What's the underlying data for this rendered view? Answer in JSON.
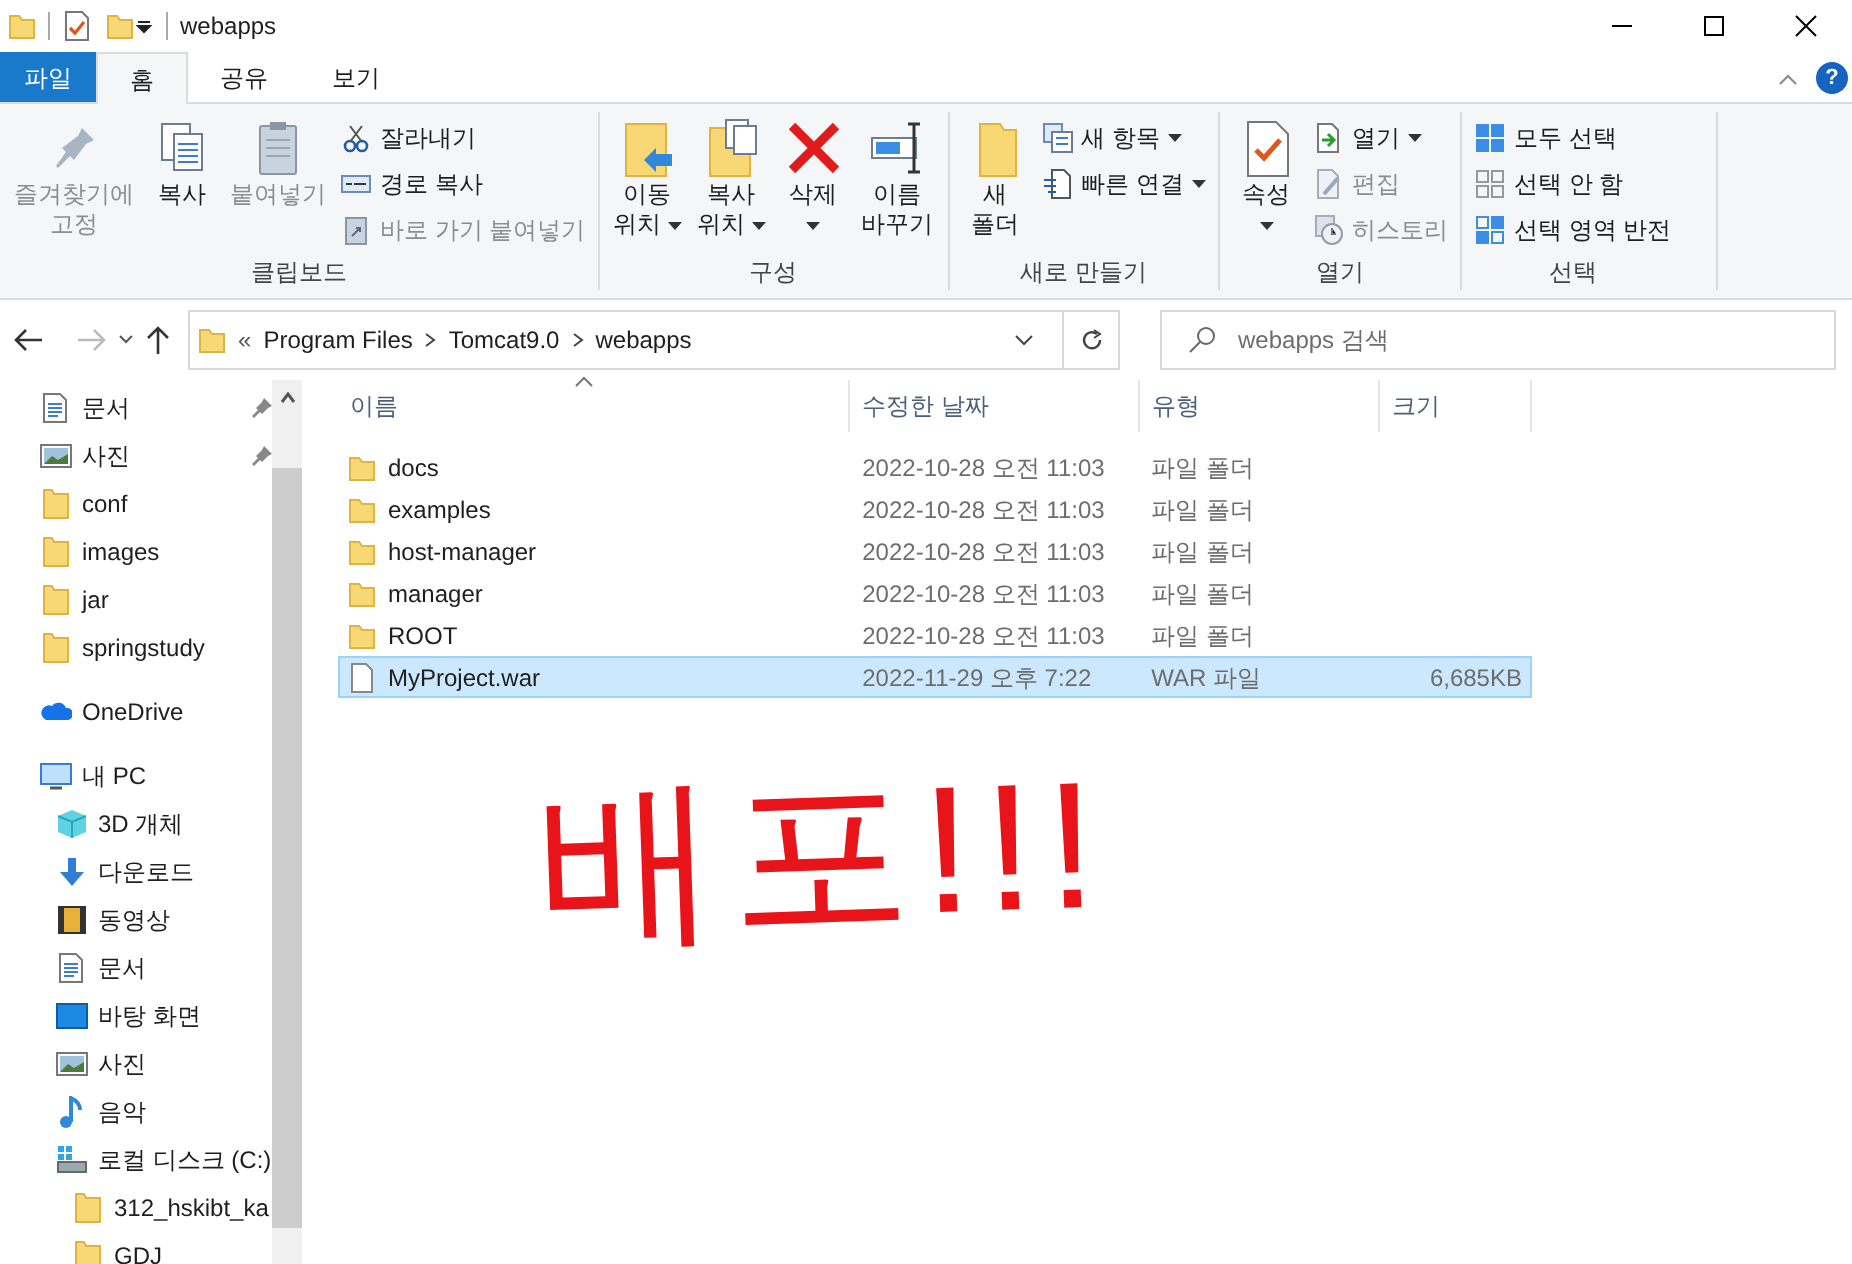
{
  "window": {
    "title": "webapps"
  },
  "help_button": {
    "label": "?"
  },
  "ribbon_tabs": [
    {
      "label": "파일",
      "kind": "file",
      "selected": false
    },
    {
      "label": "홈",
      "kind": "tab",
      "selected": true
    },
    {
      "label": "공유",
      "kind": "tab",
      "selected": false
    },
    {
      "label": "보기",
      "kind": "tab",
      "selected": false
    }
  ],
  "ribbon_groups": [
    {
      "label": "클립보드",
      "items": [
        {
          "kind": "large",
          "lines": [
            "즐겨찾기에",
            "고정"
          ],
          "disabled": true,
          "dropdown": false
        },
        {
          "kind": "large",
          "lines": [
            "복사"
          ],
          "disabled": false,
          "dropdown": false
        },
        {
          "kind": "large",
          "lines": [
            "붙여넣기"
          ],
          "disabled": true,
          "dropdown": false
        },
        {
          "kind": "stack",
          "entries": [
            {
              "label": "잘라내기",
              "disabled": false,
              "dropdown": false
            },
            {
              "label": "경로 복사",
              "disabled": false,
              "dropdown": false
            },
            {
              "label": "바로 가기 붙여넣기",
              "disabled": true,
              "dropdown": false
            }
          ]
        }
      ]
    },
    {
      "label": "구성",
      "items": [
        {
          "kind": "large",
          "lines": [
            "이동",
            "위치"
          ],
          "disabled": false,
          "dropdown": true
        },
        {
          "kind": "large",
          "lines": [
            "복사",
            "위치"
          ],
          "disabled": false,
          "dropdown": true
        },
        {
          "kind": "large",
          "lines": [
            "삭제"
          ],
          "disabled": false,
          "dropdown": true
        },
        {
          "kind": "large",
          "lines": [
            "이름",
            "바꾸기"
          ],
          "disabled": false,
          "dropdown": false
        }
      ]
    },
    {
      "label": "새로 만들기",
      "items": [
        {
          "kind": "large",
          "lines": [
            "새",
            "폴더"
          ],
          "disabled": false,
          "dropdown": false
        },
        {
          "kind": "stack",
          "entries": [
            {
              "label": "새 항목",
              "disabled": false,
              "dropdown": true
            },
            {
              "label": "빠른 연결",
              "disabled": false,
              "dropdown": true
            }
          ]
        }
      ]
    },
    {
      "label": "열기",
      "items": [
        {
          "kind": "large",
          "lines": [
            "속성"
          ],
          "disabled": false,
          "dropdown": true
        },
        {
          "kind": "stack",
          "entries": [
            {
              "label": "열기",
              "disabled": false,
              "dropdown": true
            },
            {
              "label": "편집",
              "disabled": true,
              "dropdown": false
            },
            {
              "label": "히스토리",
              "disabled": true,
              "dropdown": false
            }
          ]
        }
      ]
    },
    {
      "label": "선택",
      "items": [
        {
          "kind": "stack",
          "entries": [
            {
              "label": "모두 선택",
              "disabled": false,
              "dropdown": false
            },
            {
              "label": "선택 안 함",
              "disabled": false,
              "dropdown": false
            },
            {
              "label": "선택 영역 반전",
              "disabled": false,
              "dropdown": false
            }
          ]
        }
      ]
    }
  ],
  "address_bar": {
    "prefix": "«",
    "path": [
      "Program Files",
      "Tomcat9.0",
      "webapps"
    ]
  },
  "search": {
    "placeholder": "webapps 검색"
  },
  "sidebar": [
    {
      "label": "문서",
      "kind": "doc",
      "pinned": true
    },
    {
      "label": "사진",
      "kind": "photo",
      "pinned": true
    },
    {
      "label": "conf",
      "kind": "folder",
      "pinned": false
    },
    {
      "label": "images",
      "kind": "folder",
      "pinned": false
    },
    {
      "label": "jar",
      "kind": "folder",
      "pinned": false
    },
    {
      "label": "springstudy",
      "kind": "folder",
      "pinned": false
    },
    {
      "label": "OneDrive",
      "kind": "cloud",
      "pinned": false
    },
    {
      "label": "내 PC",
      "kind": "pc",
      "pinned": false,
      "children": [
        {
          "label": "3D 개체",
          "kind": "cube",
          "pinned": false
        },
        {
          "label": "다운로드",
          "kind": "download",
          "pinned": false
        },
        {
          "label": "동영상",
          "kind": "video",
          "pinned": false
        },
        {
          "label": "문서",
          "kind": "doc",
          "pinned": false
        },
        {
          "label": "바탕 화면",
          "kind": "desktop",
          "pinned": false
        },
        {
          "label": "사진",
          "kind": "photo",
          "pinned": false
        },
        {
          "label": "음악",
          "kind": "music",
          "pinned": false
        },
        {
          "label": "로컬 디스크 (C:)",
          "kind": "drive",
          "pinned": false,
          "children": [
            {
              "label": "312_hskibt_ka",
              "kind": "folder",
              "pinned": false
            },
            {
              "label": "GDJ",
              "kind": "folder",
              "pinned": false
            }
          ]
        }
      ]
    }
  ],
  "table": {
    "columns": [
      "이름",
      "수정한 날짜",
      "유형",
      "크기"
    ],
    "rows": [
      {
        "name": "docs",
        "kind": "folder",
        "modified": "2022-10-28 오전 11:03",
        "type": "파일 폴더",
        "selected": false
      },
      {
        "name": "examples",
        "kind": "folder",
        "modified": "2022-10-28 오전 11:03",
        "type": "파일 폴더",
        "selected": false
      },
      {
        "name": "host-manager",
        "kind": "folder",
        "modified": "2022-10-28 오전 11:03",
        "type": "파일 폴더",
        "selected": false
      },
      {
        "name": "manager",
        "kind": "folder",
        "modified": "2022-10-28 오전 11:03",
        "type": "파일 폴더",
        "selected": false
      },
      {
        "name": "ROOT",
        "kind": "folder",
        "modified": "2022-10-28 오전 11:03",
        "type": "파일 폴더",
        "selected": false
      },
      {
        "name": "MyProject.war",
        "kind": "file",
        "modified": "2022-11-29 오후 7:22",
        "type": "WAR 파일",
        "size": "6,685KB",
        "selected": true
      }
    ]
  },
  "annotation": {
    "text": "배포!!!"
  }
}
